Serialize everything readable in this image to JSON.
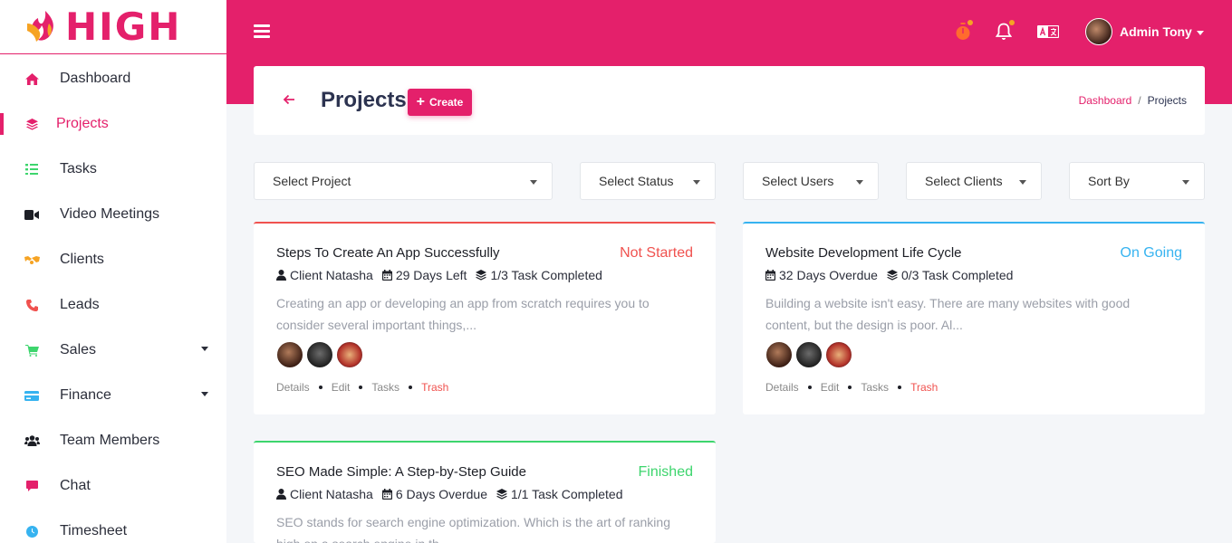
{
  "brand": {
    "logo_text": "HIGH",
    "accent": "#e4206b"
  },
  "sidebar": {
    "items": [
      {
        "label": "Dashboard",
        "icon": "home-icon",
        "color": "#e4206b"
      },
      {
        "label": "Projects",
        "icon": "layers-icon",
        "color": "#e4206b",
        "active": true
      },
      {
        "label": "Tasks",
        "icon": "list-check-icon",
        "color": "#3dd56d"
      },
      {
        "label": "Video Meetings",
        "icon": "video-icon",
        "color": "#1d1f26"
      },
      {
        "label": "Clients",
        "icon": "handshake-icon",
        "color": "#f6a323"
      },
      {
        "label": "Leads",
        "icon": "phone-icon",
        "color": "#f0524f"
      },
      {
        "label": "Sales",
        "icon": "cart-icon",
        "color": "#3dd56d",
        "has_submenu": true
      },
      {
        "label": "Finance",
        "icon": "credit-card-icon",
        "color": "#36b3f0",
        "has_submenu": true
      },
      {
        "label": "Team Members",
        "icon": "users-icon",
        "color": "#1d1f26"
      },
      {
        "label": "Chat",
        "icon": "chat-icon",
        "color": "#e4206b"
      },
      {
        "label": "Timesheet",
        "icon": "clock-icon",
        "color": "#36b3f0"
      }
    ]
  },
  "topbar": {
    "user_name": "Admin Tony",
    "icons": [
      "stopwatch-icon",
      "bell-icon",
      "language-icon"
    ]
  },
  "header": {
    "title": "Projects",
    "create_label": "Create",
    "breadcrumb": {
      "home": "Dashboard",
      "current": "Projects",
      "separator": "/"
    }
  },
  "filters": {
    "project": "Select Project",
    "status": "Select Status",
    "users": "Select Users",
    "clients": "Select Clients",
    "sort": "Sort By"
  },
  "projects": [
    {
      "title": "Steps To Create An App Successfully",
      "status": "Not Started",
      "status_color": "#f0524f",
      "client": "Client Natasha",
      "days": "29 Days Left",
      "tasks": "1/3 Task Completed",
      "description": "Creating an app or developing an app from scratch requires you to consider several important things,...",
      "actions": [
        "Details",
        "Edit",
        "Tasks",
        "Trash"
      ]
    },
    {
      "title": "Website Development Life Cycle",
      "status": "On Going",
      "status_color": "#36b3f0",
      "days": "32 Days Overdue",
      "tasks": "0/3 Task Completed",
      "description": "Building a website isn't easy. There are many websites with good content, but the design is poor. Al...",
      "actions": [
        "Details",
        "Edit",
        "Tasks",
        "Trash"
      ]
    },
    {
      "title": "SEO Made Simple: A Step-by-Step Guide",
      "status": "Finished",
      "status_color": "#3dd56d",
      "client": "Client Natasha",
      "days": "6 Days Overdue",
      "tasks": "1/1 Task Completed",
      "description": "SEO stands for search engine optimization. Which is the art of ranking high on a search engine in th...",
      "actions": [
        "Details",
        "Edit",
        "Tasks",
        "Trash"
      ]
    }
  ]
}
